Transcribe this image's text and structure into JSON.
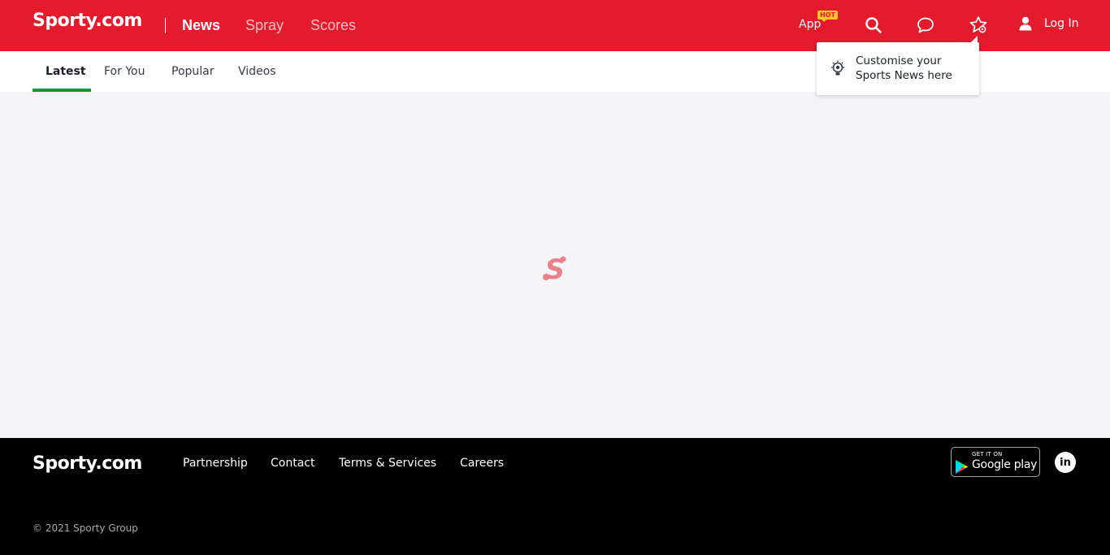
{
  "header": {
    "logo": "Sporty.com",
    "nav": [
      "News",
      "Spray",
      "Scores"
    ],
    "app_label": "App",
    "hot_badge": "HOT",
    "login_label": "Log In",
    "background_color": "#e41b2c"
  },
  "subnav": {
    "tabs": [
      "Latest",
      "For You",
      "Popular",
      "Videos"
    ],
    "active_tab": "Latest",
    "active_color": "#0d9737"
  },
  "tooltip": {
    "text": "Customise your Sports News here"
  },
  "footer": {
    "logo": "Sporty.com",
    "links": [
      "Partnership",
      "Contact",
      "Terms & Services",
      "Careers"
    ],
    "google_play_small": "GET IT ON",
    "google_play_big": "Google play",
    "linkedin_label": "in",
    "copyright": "© 2021 Sporty Group"
  },
  "icons": {
    "search": "search-icon",
    "chat": "chat-icon",
    "favorites": "star-settings-icon",
    "user": "user-icon",
    "lightbulb": "lightbulb-icon",
    "loader": "sporty-loader-icon"
  }
}
